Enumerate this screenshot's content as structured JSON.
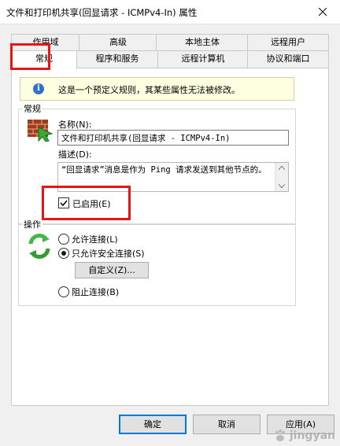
{
  "window": {
    "title": "文件和打印机共享(回显请求 - ICMPv4-In) 属性"
  },
  "tabs": {
    "row1": [
      "作用域",
      "高级",
      "本地主体",
      "远程用户"
    ],
    "row2": [
      "常规",
      "程序和服务",
      "远程计算机",
      "协议和端口"
    ]
  },
  "info": {
    "text": "这是一个预定义规则，其某些属性无法被修改。"
  },
  "general": {
    "group_label": "常规",
    "name_label": "名称(N):",
    "name_value": "文件和打印机共享(回显请求 - ICMPv4-In)",
    "desc_label": "描述(D):",
    "desc_value": "“回显请求”消息是作为 Ping 请求发送到其他节点的。",
    "enabled_label": "已启用(E)",
    "enabled": true
  },
  "action": {
    "group_label": "操作",
    "allow_label": "允许连接(L)",
    "allow_secure_label": "只允许安全连接(S)",
    "customize_label": "自定义(Z)...",
    "block_label": "阻止连接(B)",
    "selected": "allow_secure"
  },
  "footer": {
    "ok": "确定",
    "cancel": "取消",
    "apply": "应用(A)"
  },
  "colors": {
    "highlight": "#ea1414",
    "accent": "#0078d7",
    "info_bg": "#ffffe1"
  },
  "watermark": {
    "text": "jingyan"
  }
}
